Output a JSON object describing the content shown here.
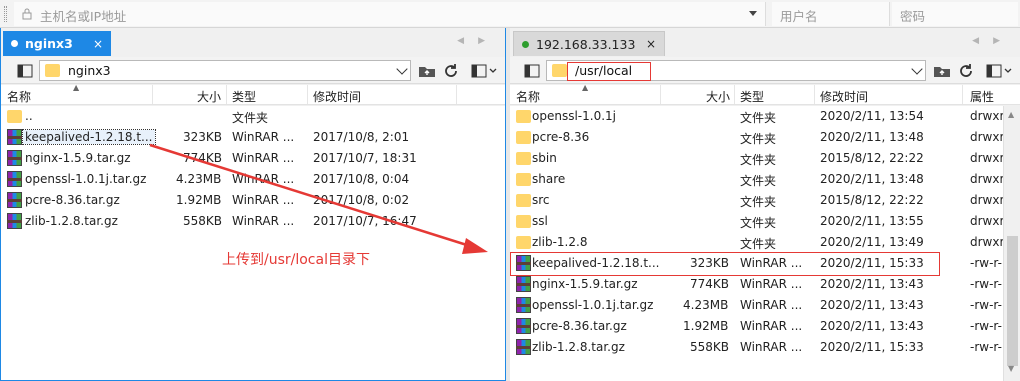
{
  "topbar": {
    "host_placeholder": "主机名或IP地址",
    "user_placeholder": "用户名",
    "pass_placeholder": "密码"
  },
  "left": {
    "tab_label": "nginx3",
    "tab_close": "×",
    "path": "nginx3",
    "columns": {
      "name": "名称",
      "size": "大小",
      "type": "类型",
      "mtime": "修改时间"
    },
    "rows": [
      {
        "name": "..",
        "size": "",
        "type": "文件夹",
        "mtime": "",
        "icon": "folder-icon"
      },
      {
        "name": "keepalived-1.2.18.t...",
        "size": "323KB",
        "type": "WinRAR ...",
        "mtime": "2017/10/8, 2:01",
        "icon": "winrar-archive-icon"
      },
      {
        "name": "nginx-1.5.9.tar.gz",
        "size": "774KB",
        "type": "WinRAR ...",
        "mtime": "2017/10/7, 18:31",
        "icon": "winrar-archive-icon"
      },
      {
        "name": "openssl-1.0.1j.tar.gz",
        "size": "4.23MB",
        "type": "WinRAR ...",
        "mtime": "2017/10/8, 0:04",
        "icon": "winrar-archive-icon"
      },
      {
        "name": "pcre-8.36.tar.gz",
        "size": "1.92MB",
        "type": "WinRAR ...",
        "mtime": "2017/10/8, 0:02",
        "icon": "winrar-archive-icon"
      },
      {
        "name": "zlib-1.2.8.tar.gz",
        "size": "558KB",
        "type": "WinRAR ...",
        "mtime": "2017/10/7, 16:47",
        "icon": "winrar-archive-icon"
      }
    ]
  },
  "right": {
    "tab_label": "192.168.33.133",
    "tab_close": "×",
    "path": "/usr/local",
    "columns": {
      "name": "名称",
      "size": "大小",
      "type": "类型",
      "mtime": "修改时间",
      "attr": "属性"
    },
    "rows": [
      {
        "name": "openssl-1.0.1j",
        "size": "",
        "type": "文件夹",
        "mtime": "2020/2/11, 13:54",
        "attr": "drwxr",
        "icon": "folder-icon"
      },
      {
        "name": "pcre-8.36",
        "size": "",
        "type": "文件夹",
        "mtime": "2020/2/11, 13:48",
        "attr": "drwxr",
        "icon": "folder-icon"
      },
      {
        "name": "sbin",
        "size": "",
        "type": "文件夹",
        "mtime": "2015/8/12, 22:22",
        "attr": "drwxr",
        "icon": "folder-icon"
      },
      {
        "name": "share",
        "size": "",
        "type": "文件夹",
        "mtime": "2020/2/11, 13:48",
        "attr": "drwxr",
        "icon": "folder-icon"
      },
      {
        "name": "src",
        "size": "",
        "type": "文件夹",
        "mtime": "2015/8/12, 22:22",
        "attr": "drwxr",
        "icon": "folder-icon"
      },
      {
        "name": "ssl",
        "size": "",
        "type": "文件夹",
        "mtime": "2020/2/11, 13:55",
        "attr": "drwxr",
        "icon": "folder-icon"
      },
      {
        "name": "zlib-1.2.8",
        "size": "",
        "type": "文件夹",
        "mtime": "2020/2/11, 13:49",
        "attr": "drwxr",
        "icon": "folder-icon"
      },
      {
        "name": "keepalived-1.2.18.t...",
        "size": "323KB",
        "type": "WinRAR ...",
        "mtime": "2020/2/11, 15:33",
        "attr": "-rw-r-",
        "icon": "winrar-archive-icon"
      },
      {
        "name": "nginx-1.5.9.tar.gz",
        "size": "774KB",
        "type": "WinRAR ...",
        "mtime": "2020/2/11, 13:43",
        "attr": "-rw-r-",
        "icon": "winrar-archive-icon"
      },
      {
        "name": "openssl-1.0.1j.tar.gz",
        "size": "4.23MB",
        "type": "WinRAR ...",
        "mtime": "2020/2/11, 13:43",
        "attr": "-rw-r-",
        "icon": "winrar-archive-icon"
      },
      {
        "name": "pcre-8.36.tar.gz",
        "size": "1.92MB",
        "type": "WinRAR ...",
        "mtime": "2020/2/11, 13:43",
        "attr": "-rw-r-",
        "icon": "winrar-archive-icon"
      },
      {
        "name": "zlib-1.2.8.tar.gz",
        "size": "558KB",
        "type": "WinRAR ...",
        "mtime": "2020/2/11, 15:33",
        "attr": "-rw-r-",
        "icon": "winrar-archive-icon"
      }
    ]
  },
  "annotation_text": "上传到/usr/local目录下",
  "colors": {
    "active_tab": "#1e88e5",
    "connected_dot_left": "#ffffff",
    "connected_dot_right": "#2e9e2e",
    "annotation_red": "#e53935",
    "folder_yellow": "#ffd66b"
  }
}
